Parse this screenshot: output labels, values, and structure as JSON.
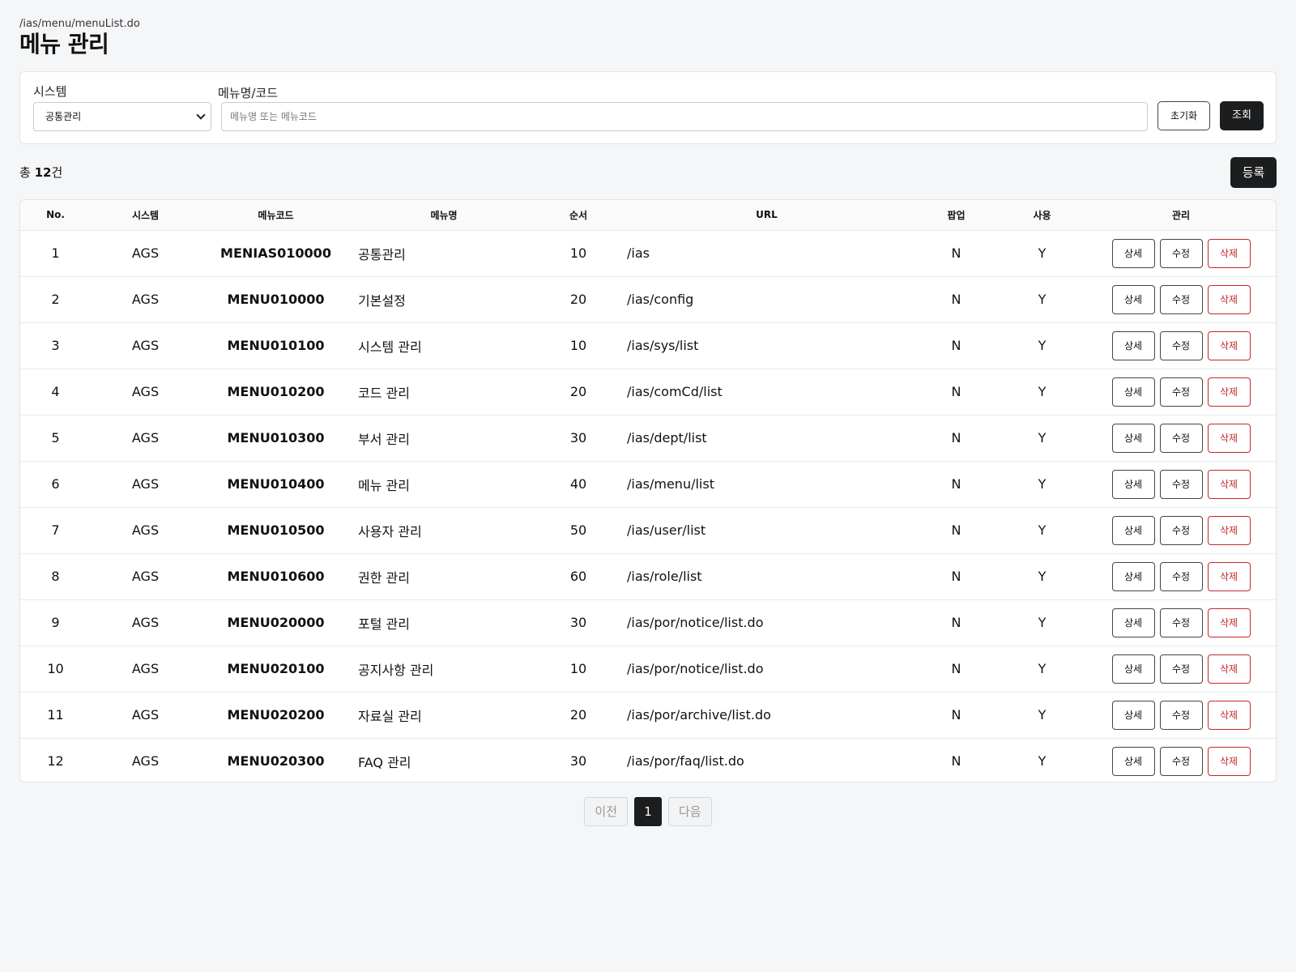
{
  "header": {
    "path": "/ias/menu/menuList.do",
    "title": "메뉴 관리"
  },
  "search": {
    "system_label": "시스템",
    "system_value": "공통관리",
    "keyword_label": "메뉴명/코드",
    "keyword_placeholder": "메뉴명 또는 메뉴코드",
    "keyword_value": "",
    "reset_label": "초기화",
    "search_label": "조회"
  },
  "summary": {
    "prefix": "총",
    "count": "12",
    "suffix": "건",
    "register_label": "등록"
  },
  "table": {
    "columns": [
      "No.",
      "시스템",
      "메뉴코드",
      "메뉴명",
      "순서",
      "URL",
      "팝업",
      "사용",
      "관리"
    ],
    "action_labels": {
      "detail": "상세",
      "edit": "수정",
      "delete": "삭제"
    },
    "rows": [
      {
        "no": "1",
        "system": "AGS",
        "code": "MENIAS010000",
        "name": "공통관리",
        "order": "10",
        "url": "/ias",
        "popup": "N",
        "use": "Y"
      },
      {
        "no": "2",
        "system": "AGS",
        "code": "MENU010000",
        "name": "기본설정",
        "order": "20",
        "url": "/ias/config",
        "popup": "N",
        "use": "Y"
      },
      {
        "no": "3",
        "system": "AGS",
        "code": "MENU010100",
        "name": "시스템 관리",
        "order": "10",
        "url": "/ias/sys/list",
        "popup": "N",
        "use": "Y"
      },
      {
        "no": "4",
        "system": "AGS",
        "code": "MENU010200",
        "name": "코드 관리",
        "order": "20",
        "url": "/ias/comCd/list",
        "popup": "N",
        "use": "Y"
      },
      {
        "no": "5",
        "system": "AGS",
        "code": "MENU010300",
        "name": "부서 관리",
        "order": "30",
        "url": "/ias/dept/list",
        "popup": "N",
        "use": "Y"
      },
      {
        "no": "6",
        "system": "AGS",
        "code": "MENU010400",
        "name": "메뉴 관리",
        "order": "40",
        "url": "/ias/menu/list",
        "popup": "N",
        "use": "Y"
      },
      {
        "no": "7",
        "system": "AGS",
        "code": "MENU010500",
        "name": "사용자 관리",
        "order": "50",
        "url": "/ias/user/list",
        "popup": "N",
        "use": "Y"
      },
      {
        "no": "8",
        "system": "AGS",
        "code": "MENU010600",
        "name": "권한 관리",
        "order": "60",
        "url": "/ias/role/list",
        "popup": "N",
        "use": "Y"
      },
      {
        "no": "9",
        "system": "AGS",
        "code": "MENU020000",
        "name": "포털 관리",
        "order": "30",
        "url": "/ias/por/notice/list.do",
        "popup": "N",
        "use": "Y"
      },
      {
        "no": "10",
        "system": "AGS",
        "code": "MENU020100",
        "name": "공지사항 관리",
        "order": "10",
        "url": "/ias/por/notice/list.do",
        "popup": "N",
        "use": "Y"
      },
      {
        "no": "11",
        "system": "AGS",
        "code": "MENU020200",
        "name": "자료실 관리",
        "order": "20",
        "url": "/ias/por/archive/list.do",
        "popup": "N",
        "use": "Y"
      },
      {
        "no": "12",
        "system": "AGS",
        "code": "MENU020300",
        "name": "FAQ 관리",
        "order": "30",
        "url": "/ias/por/faq/list.do",
        "popup": "N",
        "use": "Y"
      }
    ]
  },
  "pagination": {
    "prev_label": "이전",
    "current_page": "1",
    "next_label": "다음"
  },
  "colors": {
    "background": "#f5f6f8",
    "primary_dark": "#1c1d1f",
    "danger": "#c62828"
  }
}
